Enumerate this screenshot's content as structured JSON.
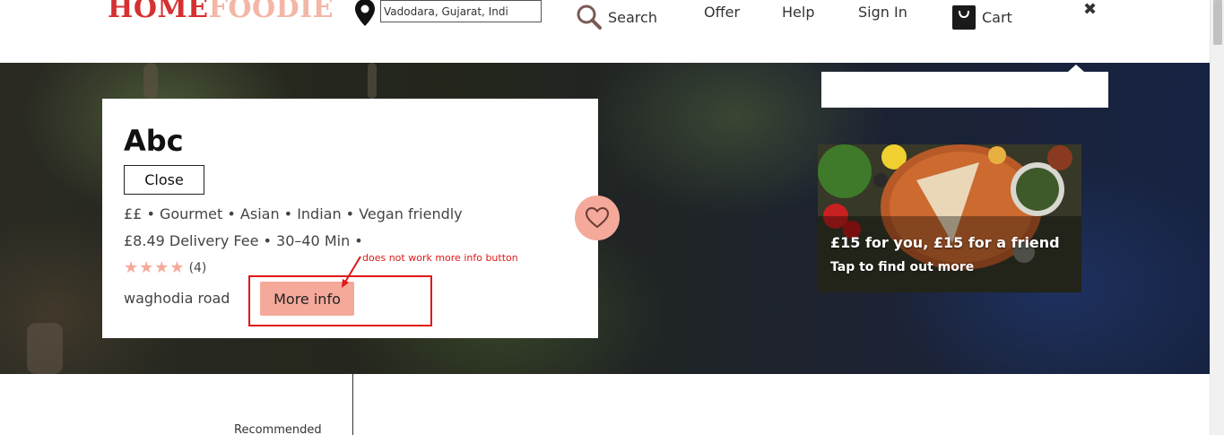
{
  "header": {
    "logo_part1": "HOME",
    "logo_part2": "FOODIE",
    "location_value": "Vadodara, Gujarat, Indi",
    "nav": {
      "search": "Search",
      "offer": "Offer",
      "help": "Help",
      "sign_in": "Sign In",
      "cart": "Cart"
    },
    "close_symbol": "✖"
  },
  "restaurant": {
    "name": "Abc",
    "close_label": "Close",
    "tags": "££ • Gourmet • Asian • Indian • Vegan friendly",
    "delivery": "£8.49 Delivery Fee • 30–40 Min •",
    "rating_stars": 4,
    "rating_count": "(4)",
    "address": "waghodia road",
    "more_info_label": "More info"
  },
  "annotation": {
    "text": "does not work more info button",
    "color": "#e01818"
  },
  "promo": {
    "title": "£15 for you, £15 for a friend",
    "subtitle": "Tap to find out more"
  },
  "lower": {
    "recommended_label": "Recommended"
  },
  "colors": {
    "accent": "#f4a99a",
    "logo_red": "#d63030",
    "logo_peach": "#f4b6a6"
  },
  "icons": [
    "location-pin-icon",
    "search-icon",
    "cart-icon",
    "close-icon",
    "heart-icon",
    "star-icon"
  ]
}
